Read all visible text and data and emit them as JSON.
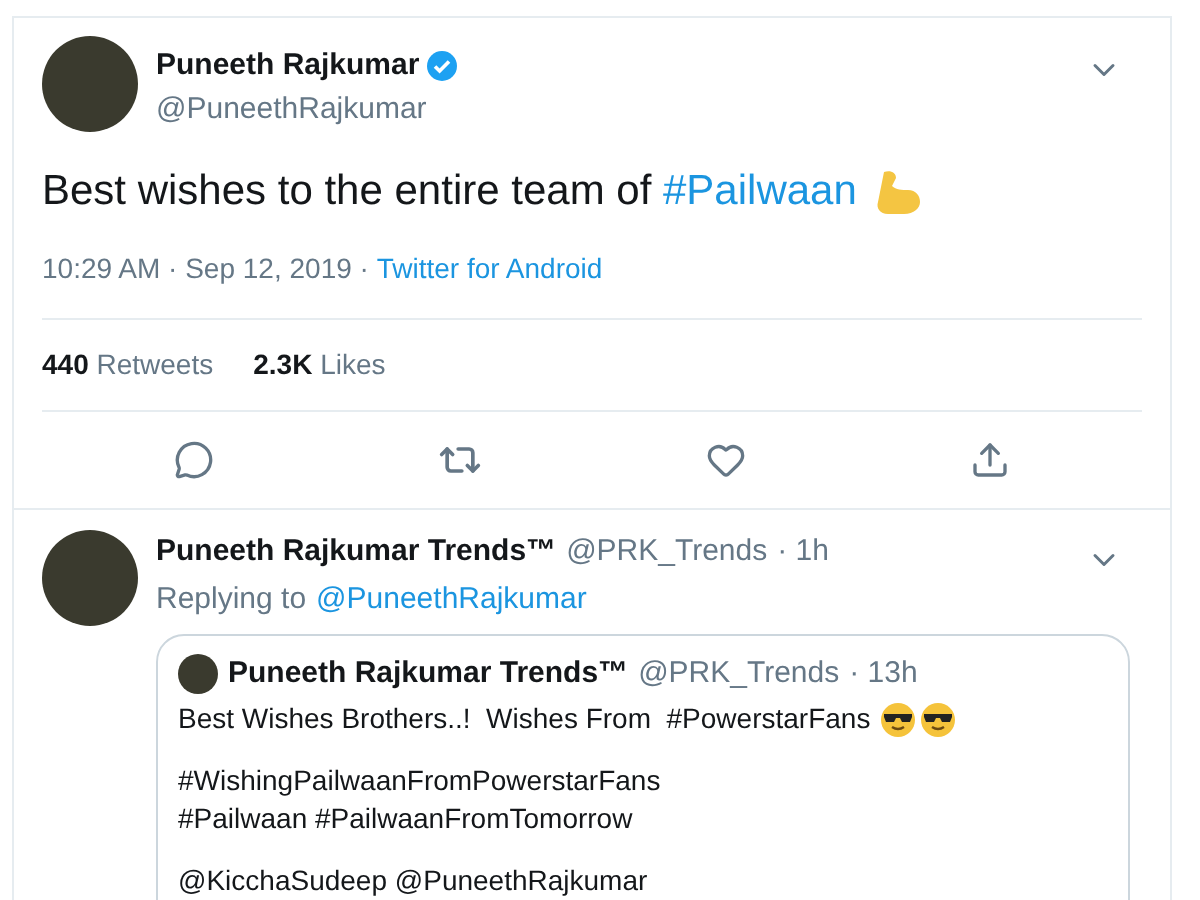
{
  "tweet": {
    "name": "Puneeth Rajkumar",
    "handle": "@PuneethRajkumar",
    "verified": true,
    "text": "Best wishes to the entire team of ",
    "hashtag": "#Pailwaan",
    "time": "10:29 AM · Sep 12, 2019 · ",
    "source": "Twitter for Android",
    "retweets": "440",
    "retweets_label": "Retweets",
    "likes": "2.3K",
    "likes_label": "Likes"
  },
  "reply": {
    "name": "Puneeth Rajkumar Trends™",
    "handle": "@PRK_Trends",
    "age": "· 1h",
    "replying_label": "Replying to",
    "replying_to": "@PuneethRajkumar",
    "quote": {
      "name": "Puneeth Rajkumar Trends™",
      "handle": "@PRK_Trends",
      "age": "· 13h",
      "paragraphs": [
        [
          "Best Wishes Brothers..!  Wishes From  #PowerstarFans"
        ],
        [
          "#WishingPailwaanFromPowerstarFans",
          "#Pailwaan #PailwaanFromTomorrow"
        ],
        [
          "@KicchaSudeep @PuneethRajkumar"
        ]
      ]
    }
  }
}
